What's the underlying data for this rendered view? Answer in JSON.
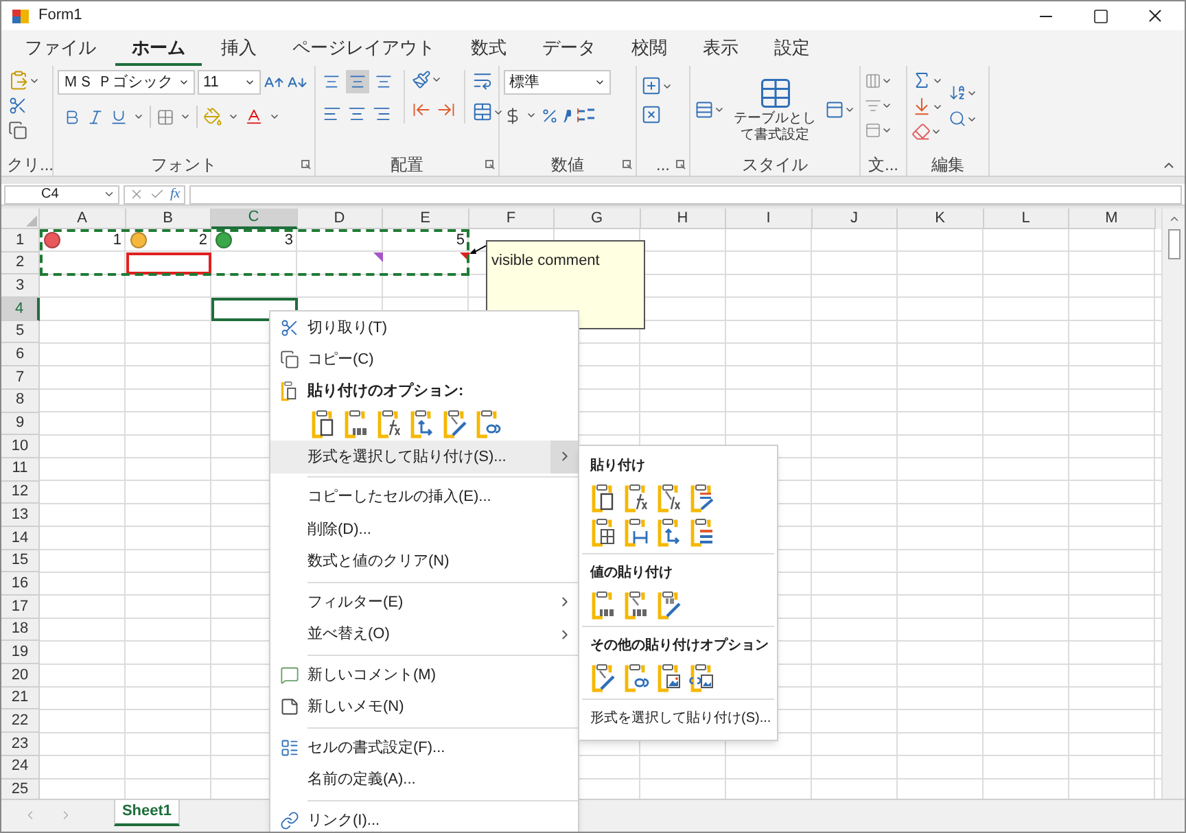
{
  "window": {
    "title": "Form1"
  },
  "tabs": [
    {
      "label": "ファイル",
      "selected": false
    },
    {
      "label": "ホーム",
      "selected": true
    },
    {
      "label": "挿入",
      "selected": false
    },
    {
      "label": "ページレイアウト",
      "selected": false
    },
    {
      "label": "数式",
      "selected": false
    },
    {
      "label": "データ",
      "selected": false
    },
    {
      "label": "校閲",
      "selected": false
    },
    {
      "label": "表示",
      "selected": false
    },
    {
      "label": "設定",
      "selected": false
    }
  ],
  "ribbon": [
    {
      "kind": "clipboard",
      "label": "クリ...",
      "launcher": false
    },
    {
      "kind": "font",
      "label": "フォント",
      "launcher": true,
      "font_name": "ＭＳ Ｐゴシック",
      "font_size": "11"
    },
    {
      "kind": "alignment",
      "label": "配置",
      "launcher": true,
      "vertical_align": [
        {
          "selected": false
        },
        {
          "selected": true
        },
        {
          "selected": false
        }
      ]
    },
    {
      "kind": "number",
      "label": "数値",
      "launcher": true,
      "number_format": "標準"
    },
    {
      "kind": "cells",
      "label": "...",
      "launcher": true
    },
    {
      "kind": "styles",
      "label": "スタイル",
      "launcher": false,
      "table_format": "テーブルとして書式設定"
    },
    {
      "kind": "text",
      "label": "文...",
      "launcher": false
    },
    {
      "kind": "editing",
      "label": "編集",
      "launcher": false
    }
  ],
  "formula_bar": {
    "name_box": "C4",
    "function_label": "fx"
  },
  "sheet": {
    "columns": [
      {
        "label": "A",
        "selected": false
      },
      {
        "label": "B",
        "selected": false
      },
      {
        "label": "C",
        "selected": true
      },
      {
        "label": "D",
        "selected": false
      },
      {
        "label": "E",
        "selected": false
      },
      {
        "label": "F",
        "selected": false
      },
      {
        "label": "G",
        "selected": false
      },
      {
        "label": "H",
        "selected": false
      },
      {
        "label": "I",
        "selected": false
      },
      {
        "label": "J",
        "selected": false
      },
      {
        "label": "K",
        "selected": false
      },
      {
        "label": "L",
        "selected": false
      },
      {
        "label": "M",
        "selected": false
      }
    ],
    "rows": [
      {
        "label": "1",
        "selected": false,
        "cells": [
          {
            "kind": "icon-value",
            "value": "1",
            "color": "#e8585c"
          },
          {
            "kind": "icon-value",
            "value": "2",
            "color": "#f5b83d"
          },
          {
            "kind": "icon-value",
            "value": "3",
            "color": "#3aa84a"
          },
          {
            "kind": "blank"
          },
          {
            "kind": "value",
            "value": "5"
          }
        ]
      },
      {
        "label": "2",
        "selected": false,
        "cells": [
          {
            "kind": "blank"
          },
          {
            "kind": "outlined"
          },
          {
            "kind": "blank"
          },
          {
            "kind": "marker",
            "color": "#a855c8"
          },
          {
            "kind": "marker",
            "color": "#e02020"
          }
        ]
      },
      {
        "label": "3",
        "selected": false
      },
      {
        "label": "4",
        "selected": true,
        "cells": [
          {
            "kind": "blank"
          },
          {
            "kind": "blank"
          },
          {
            "kind": "active"
          }
        ]
      },
      {
        "label": "5",
        "selected": false
      },
      {
        "label": "6",
        "selected": false
      },
      {
        "label": "7",
        "selected": false
      },
      {
        "label": "8",
        "selected": false
      },
      {
        "label": "9",
        "selected": false
      },
      {
        "label": "10",
        "selected": false
      },
      {
        "label": "11",
        "selected": false
      },
      {
        "label": "12",
        "selected": false
      },
      {
        "label": "13",
        "selected": false
      },
      {
        "label": "14",
        "selected": false
      },
      {
        "label": "15",
        "selected": false
      },
      {
        "label": "16",
        "selected": false
      },
      {
        "label": "17",
        "selected": false
      },
      {
        "label": "18",
        "selected": false
      },
      {
        "label": "19",
        "selected": false
      },
      {
        "label": "20",
        "selected": false
      },
      {
        "label": "21",
        "selected": false
      },
      {
        "label": "22",
        "selected": false
      },
      {
        "label": "23",
        "selected": false
      },
      {
        "label": "24",
        "selected": false
      },
      {
        "label": "25",
        "selected": false
      }
    ],
    "copy_marquee": true,
    "comment": {
      "text": "visible comment"
    }
  },
  "context_menu": [
    {
      "kind": "cut",
      "label": "切り取り(T)",
      "selected": false
    },
    {
      "kind": "copy",
      "label": "コピー(C)",
      "selected": false
    },
    {
      "kind": "header",
      "label": "貼り付けのオプション:"
    },
    {
      "kind": "icons"
    },
    {
      "kind": "submenu",
      "label": "形式を選択して貼り付け(S)...",
      "selected": true
    },
    {
      "kind": "separator"
    },
    {
      "kind": "item",
      "label": "コピーしたセルの挿入(E)...",
      "selected": false
    },
    {
      "kind": "item",
      "label": "削除(D)...",
      "selected": false
    },
    {
      "kind": "item",
      "label": "数式と値のクリア(N)",
      "selected": false
    },
    {
      "kind": "separator"
    },
    {
      "kind": "submenu",
      "label": "フィルター(E)",
      "selected": false
    },
    {
      "kind": "submenu",
      "label": "並べ替え(O)",
      "selected": false
    },
    {
      "kind": "separator"
    },
    {
      "kind": "comment",
      "label": "新しいコメント(M)",
      "selected": false
    },
    {
      "kind": "note",
      "label": "新しいメモ(N)",
      "selected": false
    },
    {
      "kind": "separator"
    },
    {
      "kind": "format",
      "label": "セルの書式設定(F)...",
      "selected": false
    },
    {
      "kind": "item",
      "label": "名前の定義(A)...",
      "selected": false
    },
    {
      "kind": "separator"
    },
    {
      "kind": "link",
      "label": "リンク(I)...",
      "selected": false
    }
  ],
  "submenu": [
    {
      "kind": "header",
      "label": "貼り付け"
    },
    {
      "kind": "icons"
    },
    {
      "kind": "icons"
    },
    {
      "kind": "separator"
    },
    {
      "kind": "header",
      "label": "値の貼り付け"
    },
    {
      "kind": "icons"
    },
    {
      "kind": "separator"
    },
    {
      "kind": "header",
      "label": "その他の貼り付けオプション"
    },
    {
      "kind": "icons"
    },
    {
      "kind": "separator"
    },
    {
      "kind": "item",
      "label": "形式を選択して貼り付け(S)...",
      "selected": false
    }
  ],
  "sheet_tabs": [
    {
      "label": "Sheet1",
      "selected": true
    }
  ]
}
